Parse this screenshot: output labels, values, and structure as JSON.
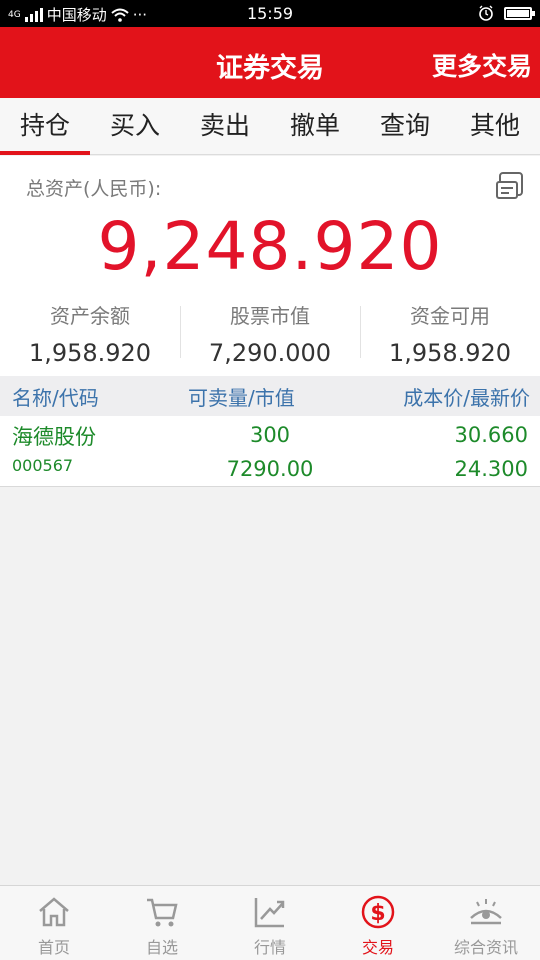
{
  "status_bar": {
    "carrier": "中国移动",
    "signal_prefix": "4G",
    "dots": "···",
    "time": "15:59"
  },
  "header": {
    "title": "证券交易",
    "more_label": "更多交易"
  },
  "tabs": [
    {
      "label": "持仓",
      "active": true
    },
    {
      "label": "买入",
      "active": false
    },
    {
      "label": "卖出",
      "active": false
    },
    {
      "label": "撤单",
      "active": false
    },
    {
      "label": "查询",
      "active": false
    },
    {
      "label": "其他",
      "active": false
    }
  ],
  "assets": {
    "label": "总资产(人民币):",
    "total": "9,248.920",
    "stats": [
      {
        "label": "资产余额",
        "value": "1,958.920"
      },
      {
        "label": "股票市值",
        "value": "7,290.000"
      },
      {
        "label": "资金可用",
        "value": "1,958.920"
      }
    ]
  },
  "table": {
    "headers": [
      "名称/代码",
      "可卖量/市值",
      "成本价/最新价"
    ],
    "rows": [
      {
        "name": "海德股份",
        "code": "000567",
        "sellable": "300",
        "market_value": "7290.00",
        "cost_price": "30.660",
        "latest_price": "24.300"
      }
    ]
  },
  "bottom_nav": [
    {
      "label": "首页",
      "icon": "home-icon",
      "active": false
    },
    {
      "label": "自选",
      "icon": "cart-icon",
      "active": false
    },
    {
      "label": "行情",
      "icon": "trend-chart-icon",
      "active": false
    },
    {
      "label": "交易",
      "icon": "dollar-icon",
      "active": true
    },
    {
      "label": "综合资讯",
      "icon": "eye-news-icon",
      "active": false
    }
  ],
  "colors": {
    "brand_red": "#e2131a",
    "total_red": "#e2132a",
    "gain_green": "#1d8a2a",
    "header_blue": "#3c73ab"
  }
}
